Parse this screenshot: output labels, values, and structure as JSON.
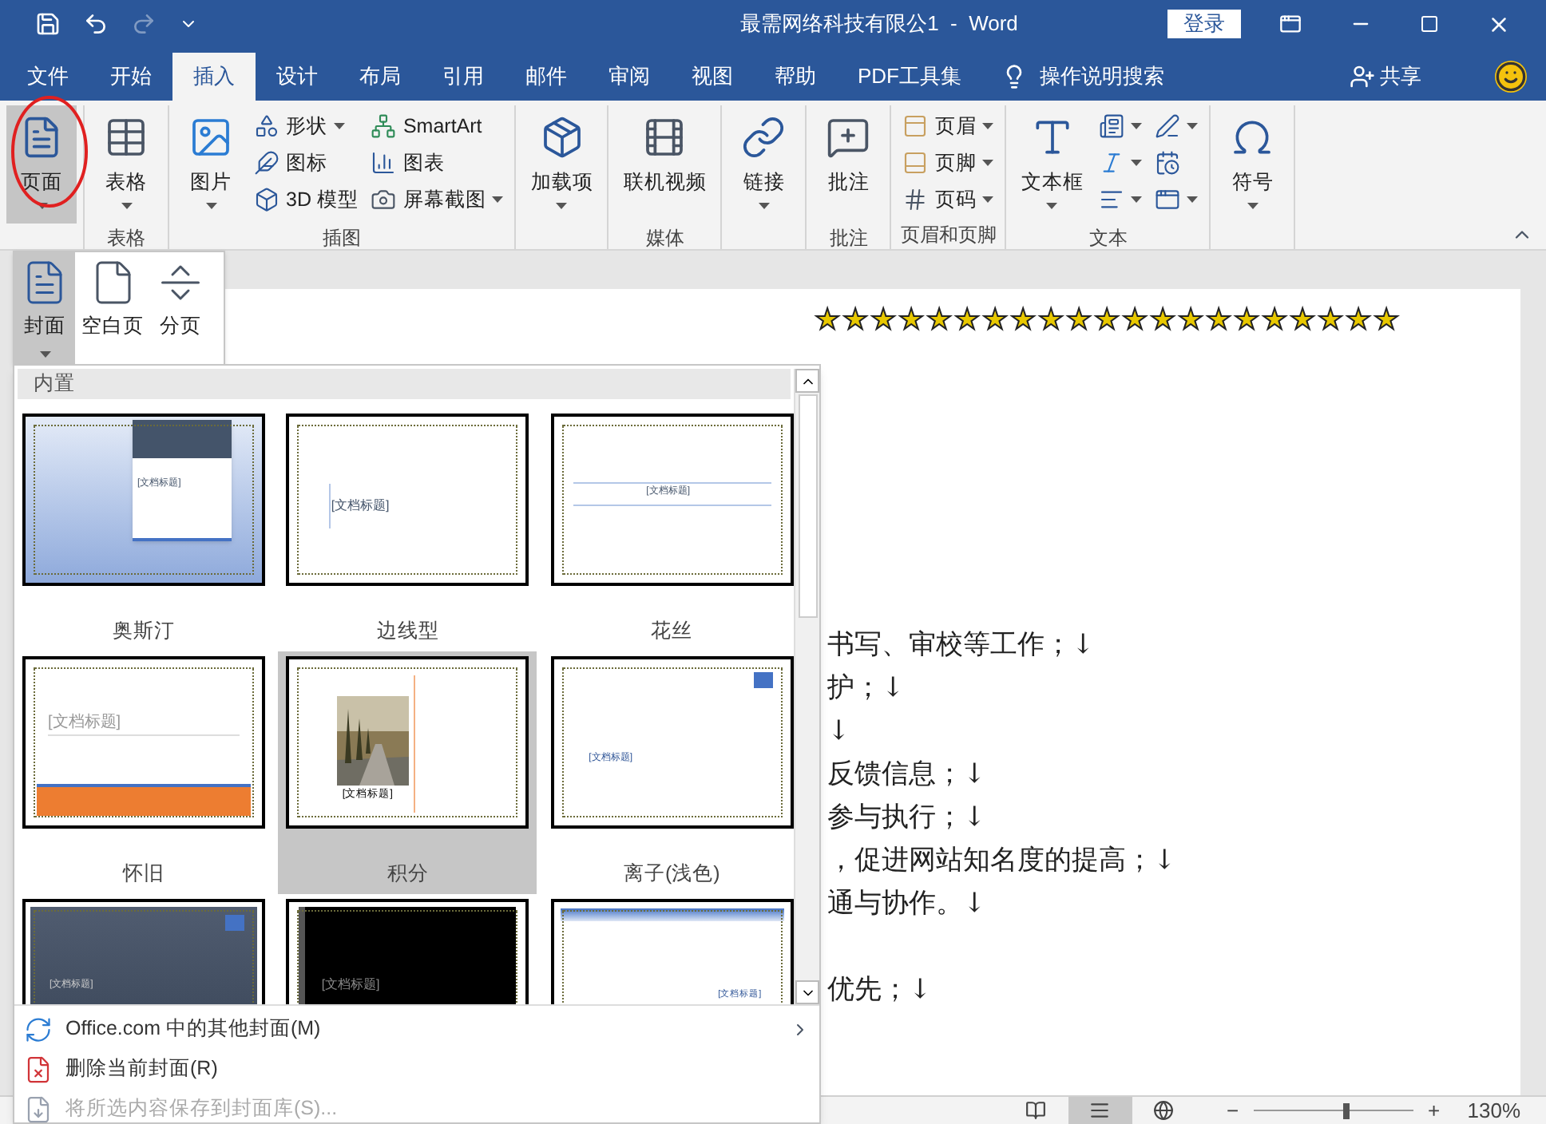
{
  "title_bar": {
    "title": "最需网络科技有限公1  -  Word",
    "login": "登录",
    "redo_disabled": true
  },
  "tabs": [
    {
      "label": "文件",
      "selected": false
    },
    {
      "label": "开始",
      "selected": false
    },
    {
      "label": "插入",
      "selected": true
    },
    {
      "label": "设计",
      "selected": false
    },
    {
      "label": "布局",
      "selected": false
    },
    {
      "label": "引用",
      "selected": false
    },
    {
      "label": "邮件",
      "selected": false
    },
    {
      "label": "审阅",
      "selected": false
    },
    {
      "label": "视图",
      "selected": false
    },
    {
      "label": "帮助",
      "selected": false
    },
    {
      "label": "PDF工具集",
      "selected": false
    }
  ],
  "tell_me": "操作说明搜索",
  "share": "共享",
  "ribbon": {
    "groups": [
      {
        "buttons": [
          {
            "kind": "large",
            "label": "页面",
            "dropdown": true,
            "pressed": true
          }
        ]
      },
      {
        "label": "表格",
        "buttons": [
          {
            "kind": "large",
            "label": "表格",
            "dropdown": true,
            "pressed": false
          }
        ]
      },
      {
        "label": "插图",
        "buttons": [
          {
            "kind": "large",
            "label": "图片",
            "dropdown": true,
            "pressed": false
          },
          {
            "kind": "small",
            "label": "形状",
            "dropdown": true,
            "pressed": false
          },
          {
            "kind": "small",
            "label": "图标",
            "dropdown": false,
            "pressed": false
          },
          {
            "kind": "small",
            "label": "3D 模型",
            "dropdown": false,
            "pressed": false
          },
          {
            "kind": "small",
            "label": "SmartArt",
            "dropdown": false,
            "pressed": false
          },
          {
            "kind": "small",
            "label": "图表",
            "dropdown": false,
            "pressed": false
          },
          {
            "kind": "small",
            "label": "屏幕截图",
            "dropdown": true,
            "pressed": false
          }
        ]
      },
      {
        "buttons": [
          {
            "kind": "large",
            "label": "加载项",
            "dropdown": true,
            "pressed": false
          }
        ]
      },
      {
        "label": "媒体",
        "buttons": [
          {
            "kind": "large",
            "label": "联机视频",
            "dropdown": false,
            "pressed": false
          }
        ]
      },
      {
        "buttons": [
          {
            "kind": "large",
            "label": "链接",
            "dropdown": true,
            "pressed": false
          }
        ]
      },
      {
        "label": "批注",
        "buttons": [
          {
            "kind": "large",
            "label": "批注",
            "dropdown": false,
            "pressed": false
          }
        ]
      },
      {
        "label": "页眉和页脚",
        "buttons": [
          {
            "kind": "small",
            "label": "页眉",
            "dropdown": true,
            "pressed": false
          },
          {
            "kind": "small",
            "label": "页脚",
            "dropdown": true,
            "pressed": false
          },
          {
            "kind": "small",
            "label": "页码",
            "dropdown": true,
            "pressed": false
          }
        ]
      },
      {
        "label": "文本",
        "buttons": [
          {
            "kind": "large",
            "label": "文本框",
            "dropdown": true,
            "pressed": false
          },
          {
            "kind": "small",
            "dropdown": true,
            "pressed": false
          },
          {
            "kind": "small",
            "dropdown": true,
            "pressed": false
          },
          {
            "kind": "small",
            "dropdown": true,
            "pressed": false
          },
          {
            "kind": "small",
            "dropdown": true,
            "pressed": false
          },
          {
            "kind": "small",
            "dropdown": false,
            "pressed": false
          },
          {
            "kind": "small",
            "dropdown": true,
            "pressed": false
          }
        ]
      },
      {
        "buttons": [
          {
            "kind": "large",
            "label": "符号",
            "dropdown": true,
            "pressed": false
          }
        ]
      }
    ]
  },
  "page_menu": {
    "buttons": [
      {
        "label": "封面",
        "dropdown": true,
        "selected": true
      },
      {
        "label": "空白页",
        "dropdown": false,
        "selected": false
      },
      {
        "label": "分页",
        "dropdown": false,
        "selected": false
      }
    ]
  },
  "cover_gallery": {
    "header": "内置",
    "items": [
      {
        "kind": "austin",
        "name": "奥斯汀",
        "title": "[文档标题]",
        "selected": false
      },
      {
        "kind": "sideline",
        "name": "边线型",
        "title": "[文档标题]",
        "selected": false
      },
      {
        "kind": "filigree",
        "name": "花丝",
        "title": "[文档标题]",
        "selected": false
      },
      {
        "kind": "retro",
        "name": "怀旧",
        "title": "[文档标题]",
        "selected": false
      },
      {
        "kind": "integral",
        "name": "积分",
        "title": "[文档标题]",
        "selected": true
      },
      {
        "kind": "ion_light",
        "name": "离子(浅色)",
        "title": "[文档标题]",
        "selected": false
      },
      {
        "kind": "ion_dark",
        "title": "[文档标题]",
        "selected": false
      },
      {
        "kind": "dark",
        "title": "[文档标题]",
        "selected": false
      },
      {
        "kind": "banded",
        "title": "[文档标题]",
        "selected": false
      }
    ],
    "menu": [
      {
        "kind": "office",
        "label": "Office.com 中的其他封面(M)",
        "submenu": true,
        "disabled": false
      },
      {
        "kind": "delete",
        "label": "删除当前封面(R)",
        "submenu": false,
        "disabled": false
      },
      {
        "kind": "save",
        "label": "将所选内容保存到封面库(S)...",
        "submenu": false,
        "disabled": true
      }
    ]
  },
  "document": {
    "stars": "★★★★★★★★★★★★★★★★★★★★★",
    "paragraphs": [
      [
        "书写、审校等工作；↓",
        "护；↓",
        "↓",
        "反馈信息；↓",
        "参与执行；↓",
        "，促进网站知名度的提高；↓",
        "通与协作。↓"
      ],
      [
        "优先；↓"
      ]
    ]
  },
  "status_bar": {
    "views": [
      {
        "kind": "read",
        "selected": false
      },
      {
        "kind": "print",
        "selected": true
      },
      {
        "kind": "web",
        "selected": false
      }
    ],
    "zoom_out": "−",
    "zoom_in": "+",
    "zoom": {
      "level": 0.58
    },
    "zoom_text": "130%"
  }
}
